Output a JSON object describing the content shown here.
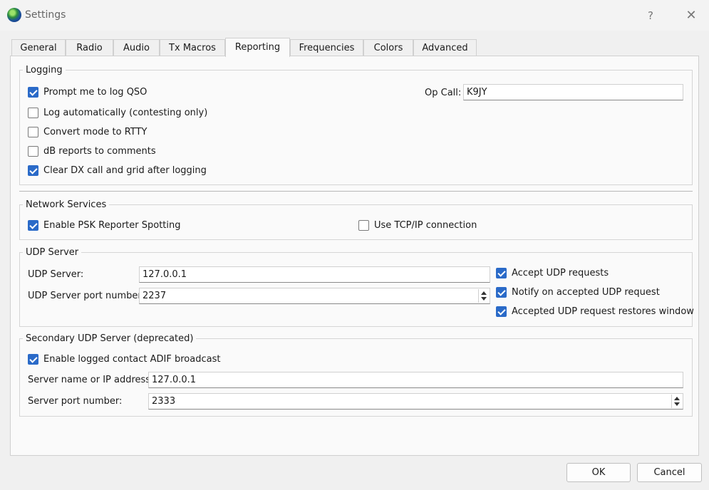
{
  "window": {
    "title": "Settings",
    "help_glyph": "?",
    "close_glyph": "✕"
  },
  "tabs": [
    {
      "label": "General"
    },
    {
      "label": "Radio"
    },
    {
      "label": "Audio"
    },
    {
      "label": "Tx Macros"
    },
    {
      "label": "Reporting"
    },
    {
      "label": "Frequencies"
    },
    {
      "label": "Colors"
    },
    {
      "label": "Advanced"
    }
  ],
  "active_tab": "Reporting",
  "logging": {
    "title": "Logging",
    "prompt_log": {
      "label": "Prompt me to log QSO",
      "checked": true
    },
    "log_auto": {
      "label": "Log automatically (contesting only)",
      "checked": false
    },
    "convert_rtty": {
      "label": "Convert mode to RTTY",
      "checked": false
    },
    "db_reports": {
      "label": "dB reports to comments",
      "checked": false
    },
    "clear_dx": {
      "label": "Clear DX call and grid after logging",
      "checked": true
    },
    "op_call_label": "Op Call:",
    "op_call_value": "K9JY"
  },
  "network": {
    "title": "Network Services",
    "psk": {
      "label": "Enable PSK Reporter Spotting",
      "checked": true
    },
    "tcp": {
      "label": "Use TCP/IP connection",
      "checked": false
    }
  },
  "udp": {
    "title": "UDP Server",
    "server_label": "UDP Server:",
    "server_value": "127.0.0.1",
    "port_label": "UDP Server port number:",
    "port_value": "2237",
    "accept": {
      "label": "Accept UDP requests",
      "checked": true
    },
    "notify": {
      "label": "Notify on accepted UDP request",
      "checked": true
    },
    "restore": {
      "label": "Accepted UDP request restores window",
      "checked": true
    }
  },
  "secondary_udp": {
    "title": "Secondary UDP Server (deprecated)",
    "adif": {
      "label": "Enable logged contact ADIF broadcast",
      "checked": true
    },
    "server_label": "Server name or IP address:",
    "server_value": "127.0.0.1",
    "port_label": "Server port number:",
    "port_value": "2333"
  },
  "buttons": {
    "ok": "OK",
    "cancel": "Cancel"
  },
  "colors": {
    "accent": "#2a6ac8",
    "panel_bg": "#fafafa",
    "window_bg": "#f0f0f0"
  }
}
